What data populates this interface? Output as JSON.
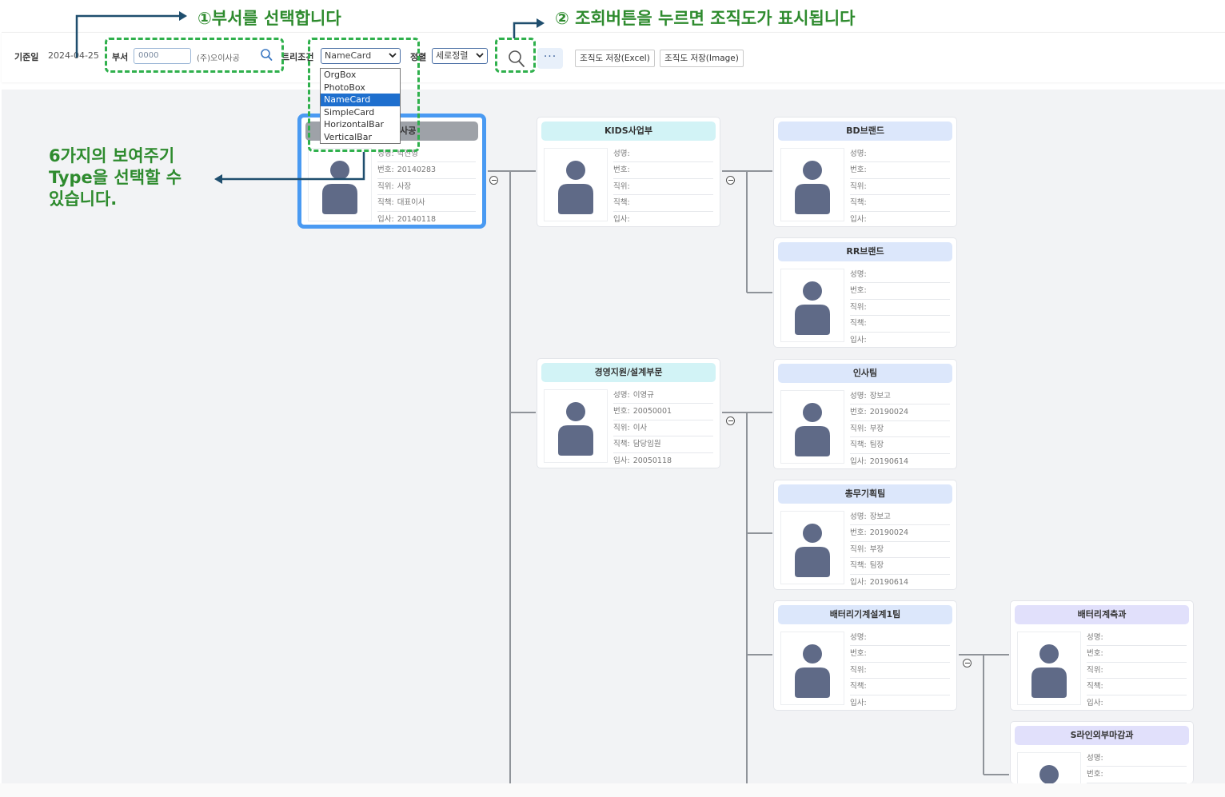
{
  "annotations": {
    "step1": "①부서를 선택합니다",
    "step2": "② 조회버튼을 누르면 조직도가 표시됩니다",
    "types_line1": "6가지의 보여주기",
    "types_line2": "Type을 선택할 수",
    "types_line3": "있습니다."
  },
  "toolbar": {
    "base_date_label": "기준일",
    "base_date_value": "2024-04-25",
    "dept_label": "부서",
    "dept_code": "0000",
    "dept_name": "(주)오이사공",
    "tree_label": "트리조건",
    "tree_selected": "NameCard",
    "align_label": "정렬",
    "align_selected": "세로정렬",
    "more": "···",
    "export_excel": "조직도 저장(Excel)",
    "export_image": "조직도 저장(Image)"
  },
  "tree_options": [
    "OrgBox",
    "PhotoBox",
    "NameCard",
    "SimpleCard",
    "HorizontalBar",
    "VerticalBar"
  ],
  "labels": {
    "name": "성명:",
    "emp_no": "번호:",
    "position": "직위:",
    "duty": "직책:",
    "hire": "입사:"
  },
  "cards": [
    {
      "title": "(주)오이사공",
      "name": "박진형",
      "emp_no": "20140283",
      "position": "사장",
      "duty": "대표이사",
      "hire": "20140118"
    },
    {
      "title": "KIDS사업부",
      "name": "",
      "emp_no": "",
      "position": "",
      "duty": "",
      "hire": ""
    },
    {
      "title": "BD브랜드",
      "name": "",
      "emp_no": "",
      "position": "",
      "duty": "",
      "hire": ""
    },
    {
      "title": "RR브랜드",
      "name": "",
      "emp_no": "",
      "position": "",
      "duty": "",
      "hire": ""
    },
    {
      "title": "경영지원/설계부문",
      "name": "이영규",
      "emp_no": "20050001",
      "position": "이사",
      "duty": "담당임원",
      "hire": "20050118"
    },
    {
      "title": "인사팀",
      "name": "장보고",
      "emp_no": "20190024",
      "position": "부장",
      "duty": "팀장",
      "hire": "20190614"
    },
    {
      "title": "총무기획팀",
      "name": "장보고",
      "emp_no": "20190024",
      "position": "부장",
      "duty": "팀장",
      "hire": "20190614"
    },
    {
      "title": "배터리기계설계1팀",
      "name": "",
      "emp_no": "",
      "position": "",
      "duty": "",
      "hire": ""
    },
    {
      "title": "배터리계측과",
      "name": "",
      "emp_no": "",
      "position": "",
      "duty": "",
      "hire": ""
    },
    {
      "title": "S라인외부마감과",
      "name": "",
      "emp_no": "",
      "position": "",
      "duty": "",
      "hire": ""
    }
  ],
  "colors": {
    "annotation_green": "#2e8b2e",
    "dashed_green": "#2fb04c",
    "selected_card_border": "#4a9af2",
    "selected_option": "#1e6fce",
    "avatar": "#5f6a87"
  }
}
